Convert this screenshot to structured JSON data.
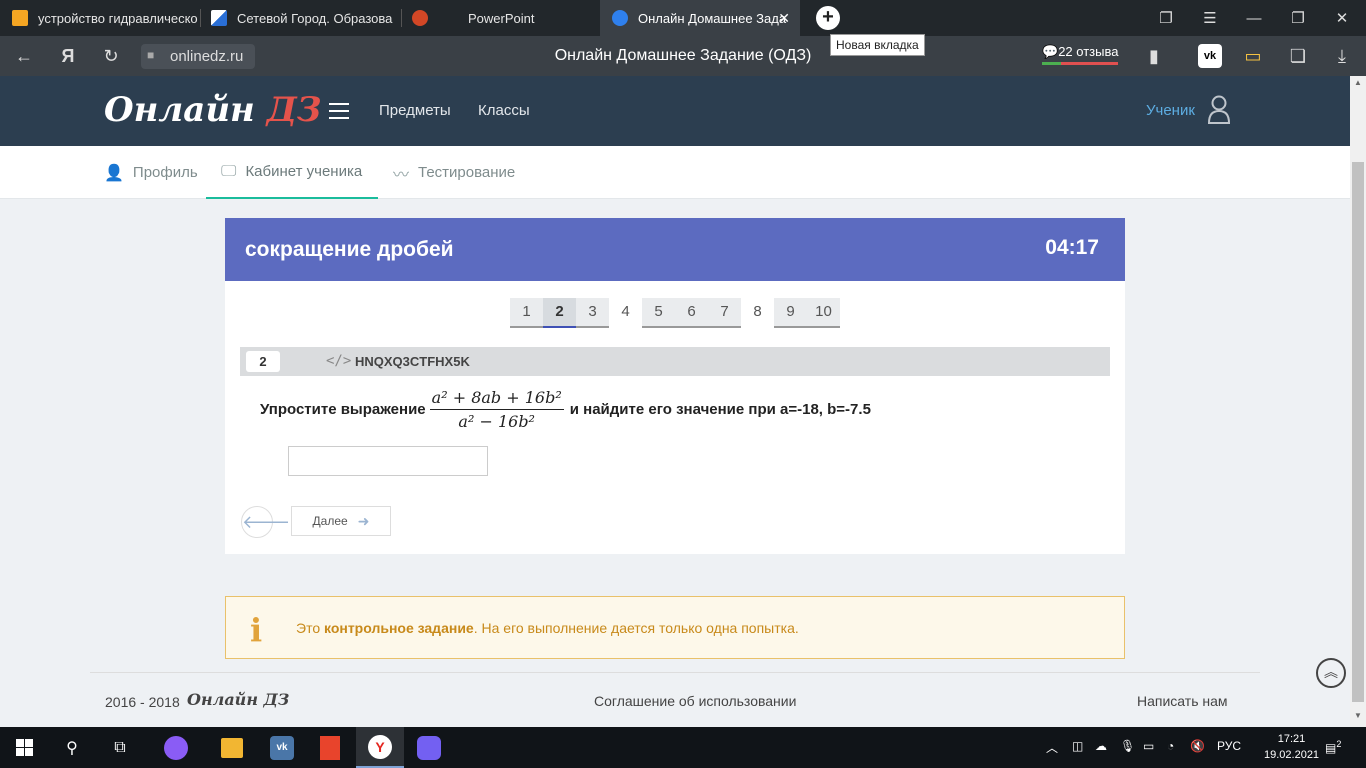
{
  "browser": {
    "tabs": [
      {
        "label": "устройство гидравлическо"
      },
      {
        "label": "Сетевой Город. Образова"
      },
      {
        "label": "PowerPoint"
      },
      {
        "label": "Онлайн Домашнее Зада"
      }
    ],
    "tooltip": "Новая вкладка",
    "address_domain": "onlinedz.ru",
    "page_title": "Онлайн Домашнее Задание (ОДЗ)",
    "reviews": "22 отзыва"
  },
  "site": {
    "logo_main": "Онлайн",
    "logo_accent": "ДЗ",
    "menu": [
      "Предметы",
      "Классы"
    ],
    "user_label": "Ученик",
    "subnav": [
      "Профиль",
      "Кабинет ученика",
      "Тестирование"
    ]
  },
  "task": {
    "title": "сокращение дробей",
    "timer": "04:17",
    "pages": [
      "1",
      "2",
      "3",
      "4",
      "5",
      "6",
      "7",
      "8",
      "9",
      "10"
    ],
    "question_number": "2",
    "code": "HNQXQ3CTFHX5K",
    "question_prefix": "Упростите выражение",
    "fraction_numerator": "a² + 8ab + 16b²",
    "fraction_denominator": "a² − 16b²",
    "question_suffix": "и найдите его значение при a=-18, b=-7.5",
    "next_label": "Далее"
  },
  "notice": {
    "pre": "Это",
    "bold": "контрольное задание",
    "post": ". На его выполнение дается только одна попытка."
  },
  "footer": {
    "years": "2016 - 2018",
    "logo": "Онлайн ДЗ",
    "agreement": "Соглашение об использовании",
    "contact": "Написать нам"
  },
  "taskbar": {
    "language": "РУС",
    "time": "17:21",
    "date": "19.02.2021",
    "notifications": "2"
  },
  "colors": {
    "header_bg": "#2c3e50",
    "card_header": "#5c6bc0",
    "accent_red": "#e5534b",
    "link_blue": "#5dade2",
    "notice_text": "#c88a1b"
  }
}
